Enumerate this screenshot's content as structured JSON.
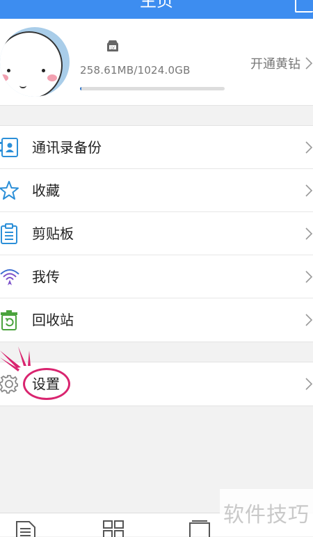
{
  "header": {
    "title": "主页"
  },
  "profile": {
    "storage_text": "258.61MB/1024.0GB",
    "storage_used_fraction": 0.0025,
    "vip_label": "开通黄钻"
  },
  "menu": {
    "items": [
      {
        "label": "通讯录备份",
        "icon": "contacts-backup-icon"
      },
      {
        "label": "收藏",
        "icon": "star-icon"
      },
      {
        "label": "剪贴板",
        "icon": "clipboard-icon"
      },
      {
        "label": "我传",
        "icon": "wireless-transfer-icon"
      },
      {
        "label": "回收站",
        "icon": "recycle-bin-icon"
      }
    ],
    "settings": {
      "label": "设置",
      "icon": "gear-icon"
    }
  },
  "watermark": {
    "text": "软件技巧"
  },
  "colors": {
    "header": "#3d8df0",
    "highlight": "#d9246f",
    "storage_bar": "#2c73c9"
  }
}
